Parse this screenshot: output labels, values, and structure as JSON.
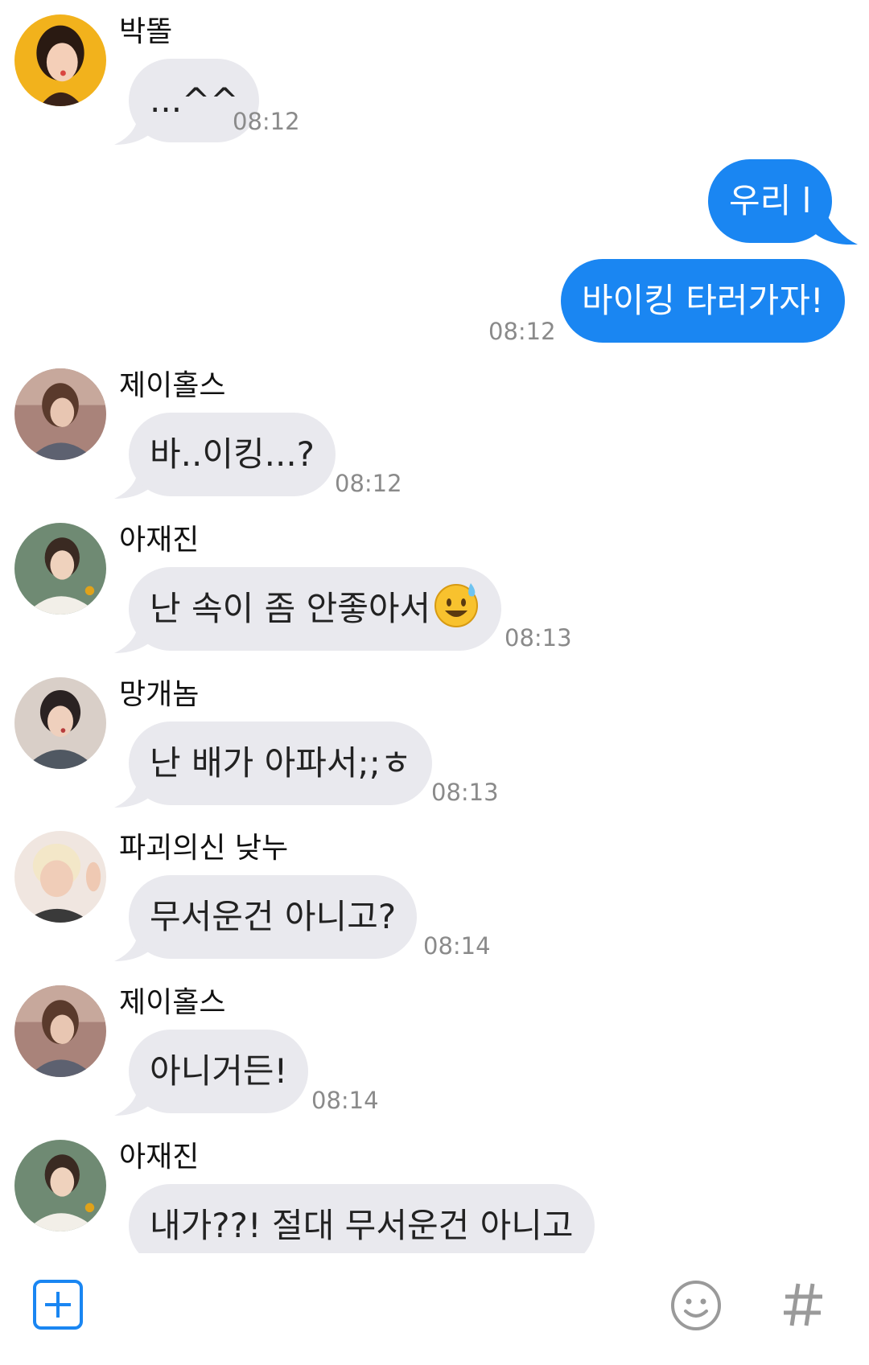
{
  "colors": {
    "accent_blue": "#1a86f2",
    "incoming_bubble": "#e9e9ee",
    "timestamp_gray": "#8a8a8a",
    "icon_gray": "#9a9a9a"
  },
  "messages": [
    {
      "id": 0,
      "direction": "in",
      "sender": "박똘",
      "text": "...^^",
      "time": "08:12"
    },
    {
      "id": 1,
      "direction": "out",
      "text": "우리 l"
    },
    {
      "id": 2,
      "direction": "out",
      "text": "바이킹 타러가자!",
      "time": "08:12"
    },
    {
      "id": 3,
      "direction": "in",
      "sender": "제이홀스",
      "text": "바..이킹...?",
      "time": "08:12"
    },
    {
      "id": 4,
      "direction": "in",
      "sender": "아재진",
      "text": "난 속이 좀 안좋아서",
      "emoji": "sweat-smile-emoji",
      "time": "08:13"
    },
    {
      "id": 5,
      "direction": "in",
      "sender": "망개놈",
      "text": "난 배가 아파서;;ㅎ",
      "time": "08:13"
    },
    {
      "id": 6,
      "direction": "in",
      "sender": "파괴의신 낮누",
      "text": "무서운건 아니고?",
      "time": "08:14"
    },
    {
      "id": 7,
      "direction": "in",
      "sender": "제이홀스",
      "text": "아니거든!",
      "time": "08:14"
    },
    {
      "id": 8,
      "direction": "in",
      "sender": "아재진",
      "text": "내가??! 절대 무서운건 아니고"
    }
  ],
  "input_bar": {
    "add_icon": "plus-square-icon",
    "emoji_icon": "smiley-icon",
    "hashtag_icon": "hashtag-icon"
  }
}
